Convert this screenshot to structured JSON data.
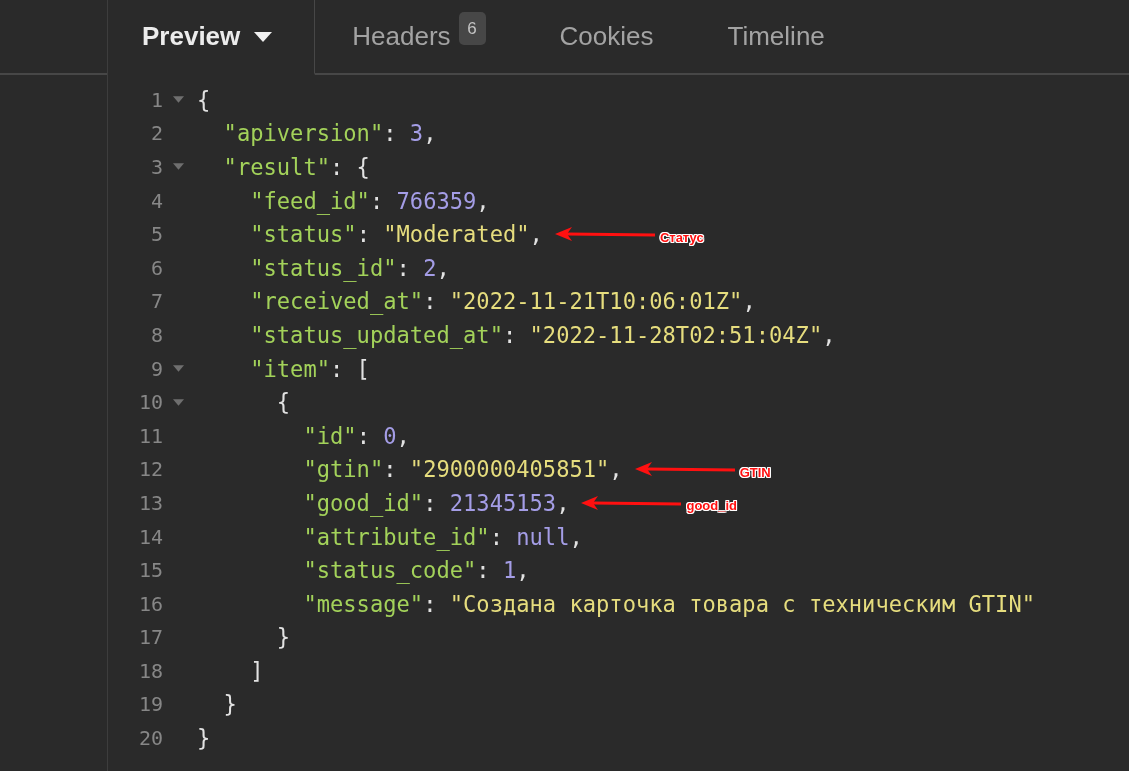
{
  "tabs": [
    {
      "label": "Preview",
      "selected": true,
      "dropdown": true
    },
    {
      "label": "Headers",
      "selected": false,
      "dropdown": false,
      "badge": "6"
    },
    {
      "label": "Cookies",
      "selected": false,
      "dropdown": false
    },
    {
      "label": "Timeline",
      "selected": false,
      "dropdown": false
    }
  ],
  "response_body": {
    "line": "1",
    "tokens": [
      {
        "kind": "punct",
        "text": "{"
      }
    ],
    "expanded": true,
    "children": [
      {
        "line": "2",
        "tokens": [
          {
            "kind": "key",
            "text": "\"apiversion\""
          },
          {
            "kind": "punct",
            "text": ": "
          },
          {
            "kind": "number",
            "text": "3"
          },
          {
            "kind": "punct",
            "text": ","
          }
        ]
      },
      {
        "line": "3",
        "tokens": [
          {
            "kind": "key",
            "text": "\"result\""
          },
          {
            "kind": "punct",
            "text": ": {"
          }
        ],
        "expanded": true,
        "children": [
          {
            "line": "4",
            "tokens": [
              {
                "kind": "key",
                "text": "\"feed_id\""
              },
              {
                "kind": "punct",
                "text": ": "
              },
              {
                "kind": "number",
                "text": "766359"
              },
              {
                "kind": "punct",
                "text": ","
              }
            ]
          },
          {
            "line": "5",
            "tokens": [
              {
                "kind": "key",
                "text": "\"status\""
              },
              {
                "kind": "punct",
                "text": ": "
              },
              {
                "kind": "string",
                "text": "\"Moderated\""
              },
              {
                "kind": "punct",
                "text": ","
              }
            ],
            "annotation": "Статус"
          },
          {
            "line": "6",
            "tokens": [
              {
                "kind": "key",
                "text": "\"status_id\""
              },
              {
                "kind": "punct",
                "text": ": "
              },
              {
                "kind": "number",
                "text": "2"
              },
              {
                "kind": "punct",
                "text": ","
              }
            ]
          },
          {
            "line": "7",
            "tokens": [
              {
                "kind": "key",
                "text": "\"received_at\""
              },
              {
                "kind": "punct",
                "text": ": "
              },
              {
                "kind": "string",
                "text": "\"2022-11-21T10:06:01Z\""
              },
              {
                "kind": "punct",
                "text": ","
              }
            ]
          },
          {
            "line": "8",
            "tokens": [
              {
                "kind": "key",
                "text": "\"status_updated_at\""
              },
              {
                "kind": "punct",
                "text": ": "
              },
              {
                "kind": "string",
                "text": "\"2022-11-28T02:51:04Z\""
              },
              {
                "kind": "punct",
                "text": ","
              }
            ]
          },
          {
            "line": "9",
            "tokens": [
              {
                "kind": "key",
                "text": "\"item\""
              },
              {
                "kind": "punct",
                "text": ": ["
              }
            ],
            "expanded": true,
            "children": [
              {
                "line": "10",
                "tokens": [
                  {
                    "kind": "punct",
                    "text": "{"
                  }
                ],
                "expanded": true,
                "children": [
                  {
                    "line": "11",
                    "tokens": [
                      {
                        "kind": "key",
                        "text": "\"id\""
                      },
                      {
                        "kind": "punct",
                        "text": ": "
                      },
                      {
                        "kind": "number",
                        "text": "0"
                      },
                      {
                        "kind": "punct",
                        "text": ","
                      }
                    ]
                  },
                  {
                    "line": "12",
                    "tokens": [
                      {
                        "kind": "key",
                        "text": "\"gtin\""
                      },
                      {
                        "kind": "punct",
                        "text": ": "
                      },
                      {
                        "kind": "string",
                        "text": "\"2900000405851\""
                      },
                      {
                        "kind": "punct",
                        "text": ","
                      }
                    ],
                    "annotation": "GTIN"
                  },
                  {
                    "line": "13",
                    "tokens": [
                      {
                        "kind": "key",
                        "text": "\"good_id\""
                      },
                      {
                        "kind": "punct",
                        "text": ": "
                      },
                      {
                        "kind": "number",
                        "text": "21345153"
                      },
                      {
                        "kind": "punct",
                        "text": ","
                      }
                    ],
                    "annotation": "good_id"
                  },
                  {
                    "line": "14",
                    "tokens": [
                      {
                        "kind": "key",
                        "text": "\"attribute_id\""
                      },
                      {
                        "kind": "punct",
                        "text": ": "
                      },
                      {
                        "kind": "literal",
                        "text": "null"
                      },
                      {
                        "kind": "punct",
                        "text": ","
                      }
                    ]
                  },
                  {
                    "line": "15",
                    "tokens": [
                      {
                        "kind": "key",
                        "text": "\"status_code\""
                      },
                      {
                        "kind": "punct",
                        "text": ": "
                      },
                      {
                        "kind": "number",
                        "text": "1"
                      },
                      {
                        "kind": "punct",
                        "text": ","
                      }
                    ]
                  },
                  {
                    "line": "16",
                    "tokens": [
                      {
                        "kind": "key",
                        "text": "\"message\""
                      },
                      {
                        "kind": "punct",
                        "text": ": "
                      },
                      {
                        "kind": "string",
                        "text": "\"Создана карточка товара с техническим GTIN\""
                      }
                    ]
                  }
                ],
                "close": {
                  "line": "17",
                  "tokens": [
                    {
                      "kind": "punct",
                      "text": "}"
                    }
                  ]
                }
              }
            ],
            "close": {
              "line": "18",
              "tokens": [
                {
                  "kind": "punct",
                  "text": "]"
                }
              ]
            }
          }
        ],
        "close": {
          "line": "19",
          "tokens": [
            {
              "kind": "punct",
              "text": "}"
            }
          ]
        }
      }
    ],
    "close": {
      "line": "20",
      "tokens": [
        {
          "kind": "punct",
          "text": "}"
        }
      ]
    }
  }
}
